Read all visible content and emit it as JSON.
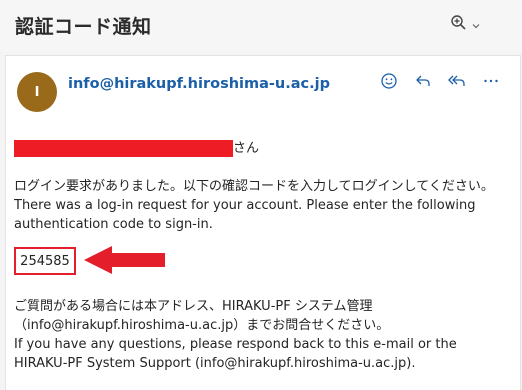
{
  "header": {
    "subject": "認証コード通知"
  },
  "message": {
    "avatar_initial": "I",
    "sender": "info@hirakupf.hiroshima-u.ac.jp",
    "greeting_suffix": "さん",
    "line1_ja": "ログイン要求がありました。以下の確認コードを入力してログインしてください。",
    "line2_en": "There was a log-in request for your account. Please enter the following authentication code to sign-in.",
    "code": "254585",
    "contact_ja_1": "ご質問がある場合には本アドレス、HIRAKU-PF システム管理",
    "contact_ja_2": "（info@hirakupf.hiroshima-u.ac.jp）までお問合せください。",
    "contact_en": "If you have any questions, please respond back to this e-mail or the HIRAKU-PF System Support (info@hirakupf.hiroshima-u.ac.jp)."
  },
  "icons": {
    "zoom": "zoom-in-icon",
    "zoom_dropdown": "chevron-down-icon",
    "emoji": "smiley-icon",
    "reply": "reply-icon",
    "reply_all": "reply-all-icon",
    "more": "more-icon"
  },
  "colors": {
    "accent": "#1b60a8",
    "avatar": "#9a6a1b",
    "highlight_red": "#e41e2a"
  }
}
